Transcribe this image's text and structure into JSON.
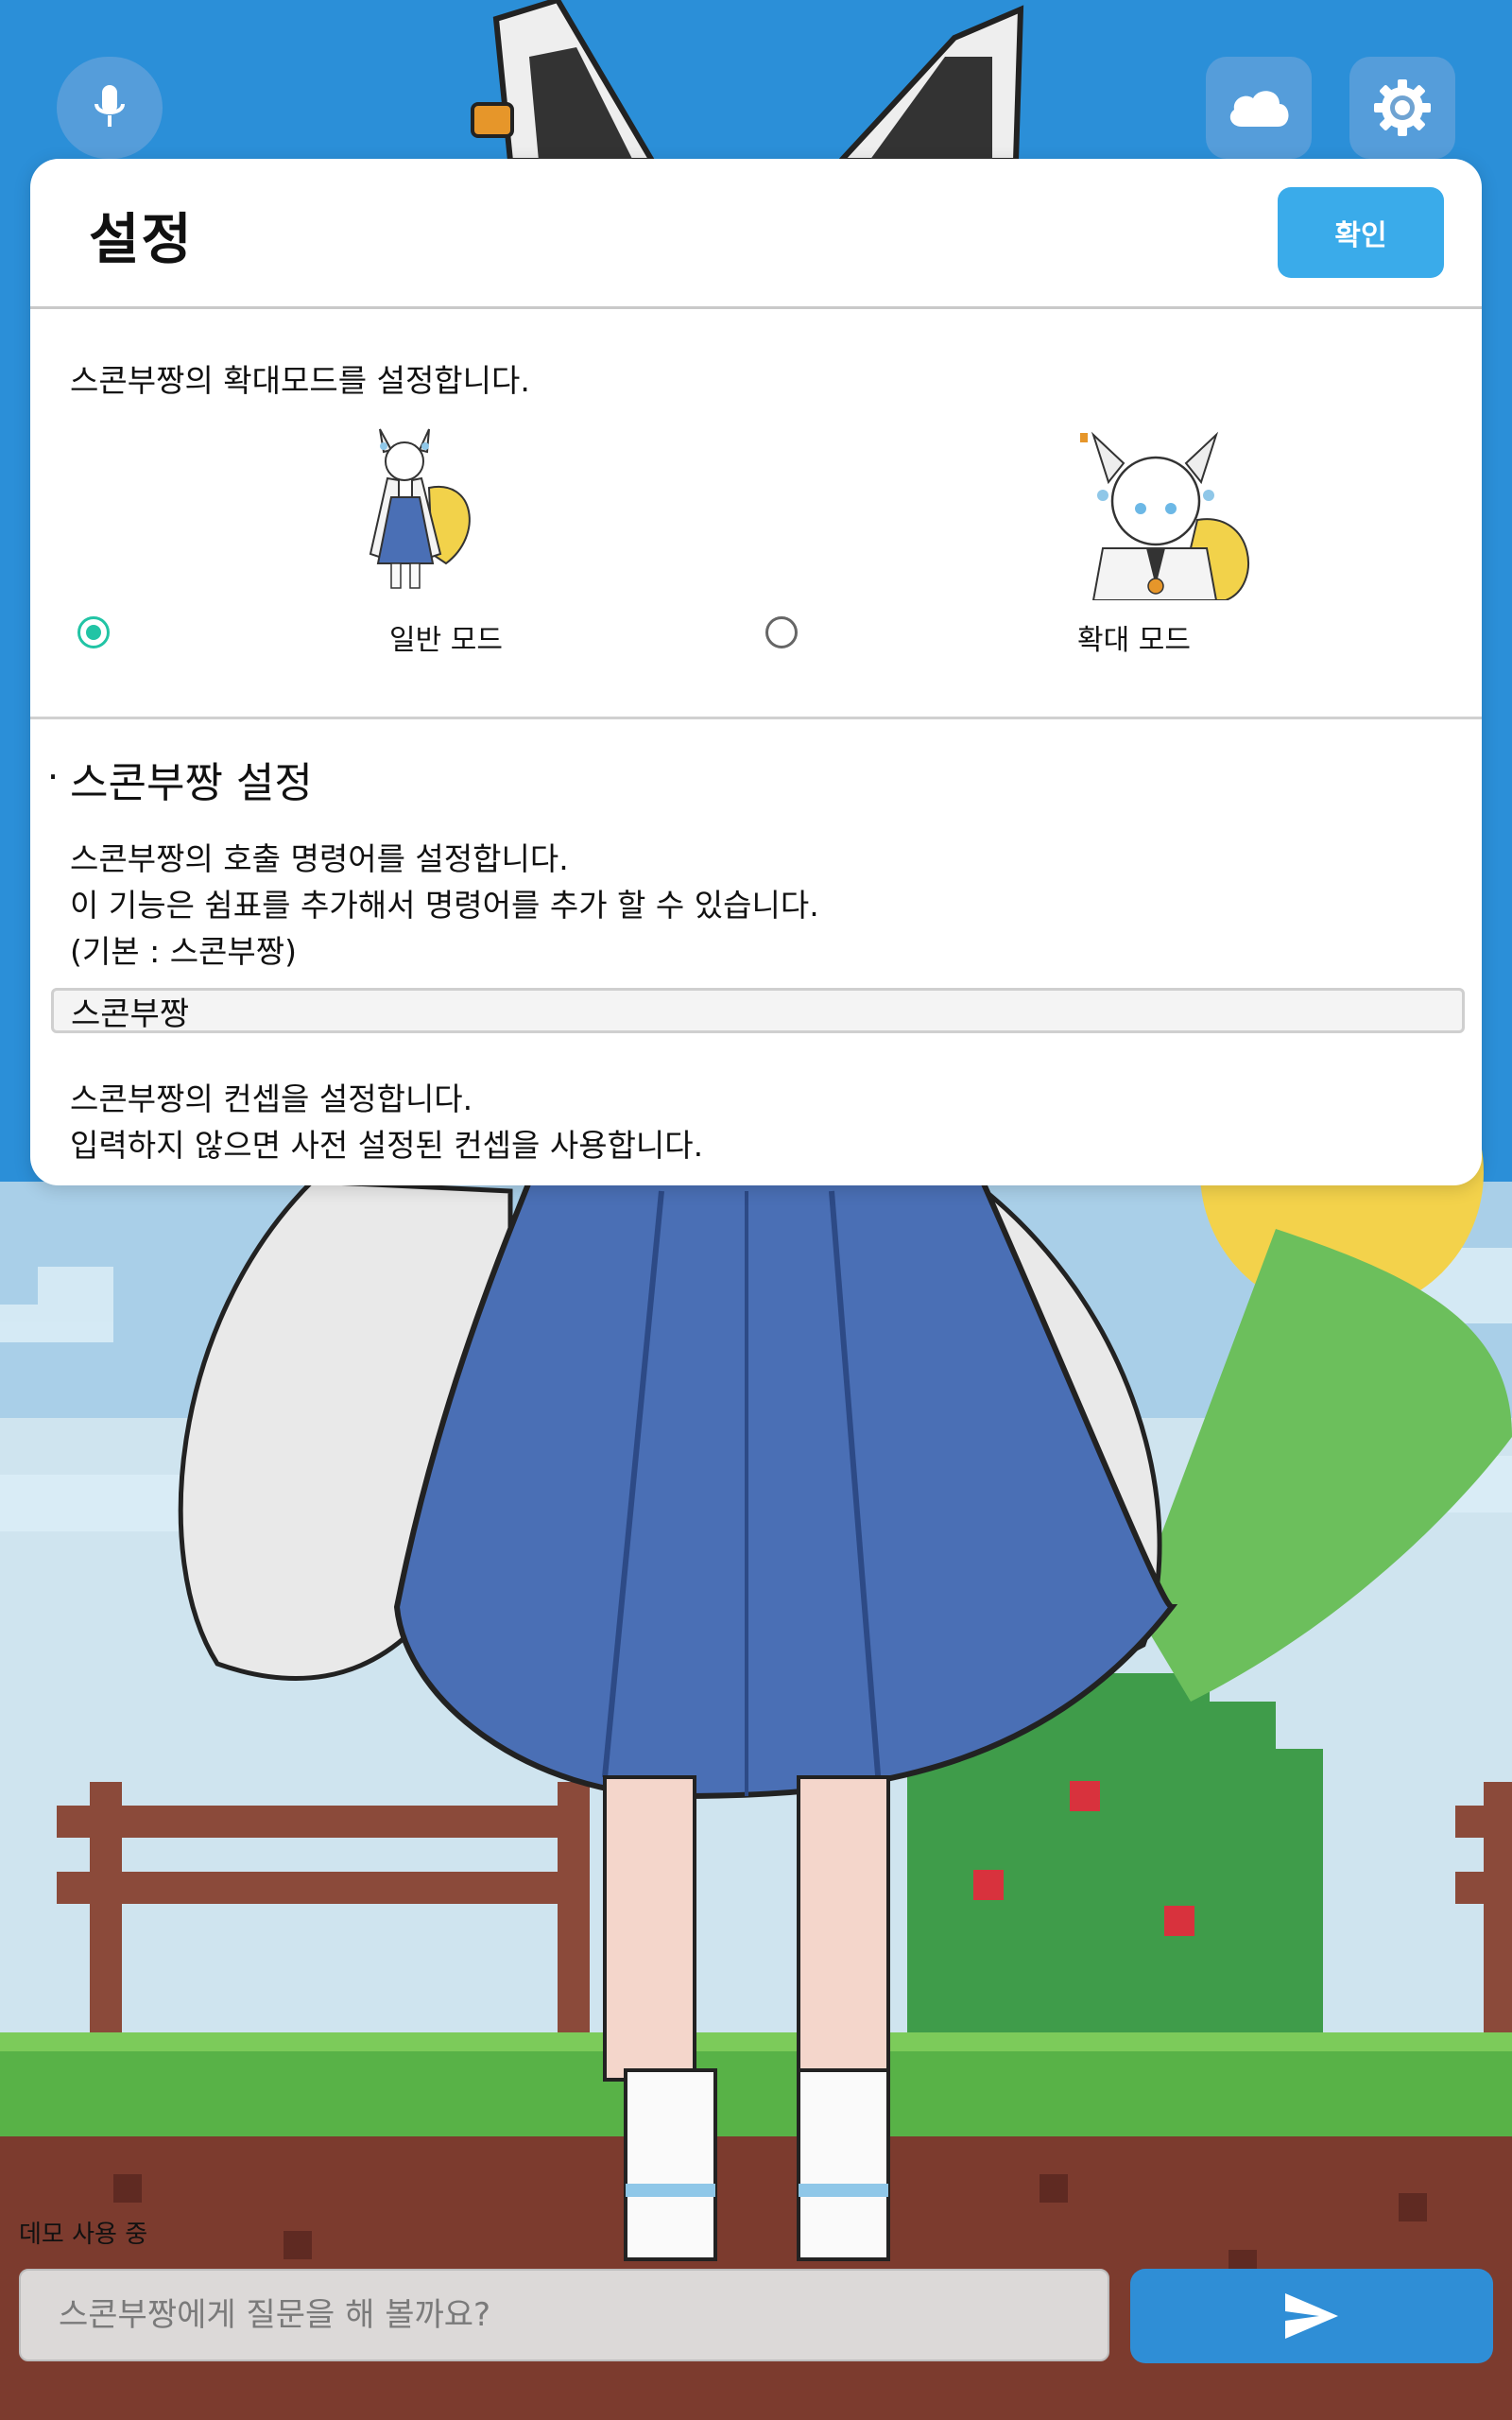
{
  "top_bar": {
    "mic_icon": "microphone-icon",
    "cloud_icon": "cloud-icon",
    "settings_icon": "gear-icon"
  },
  "dialog": {
    "title": "설정",
    "confirm_label": "확인",
    "mode_section": {
      "description": "스콘부짱의 확대모드를 설정합니다.",
      "options": [
        {
          "label": "일반 모드",
          "selected": true
        },
        {
          "label": "확대 모드",
          "selected": false
        }
      ]
    },
    "settings_section": {
      "bullet": "·",
      "title": "스콘부짱 설정",
      "call_desc_1": "스콘부짱의 호출 명령어를 설정합니다.",
      "call_desc_2": "이 기능은 쉼표를 추가해서 명령어를 추가 할 수 있습니다.",
      "call_desc_3": "(기본 : 스콘부짱)",
      "call_word_value": "스콘부짱",
      "concept_desc_1": "스콘부짱의 컨셉을 설정합니다.",
      "concept_desc_2": "입력하지 않으면 사전 설정된 컨셉을 사용합니다."
    }
  },
  "bottom": {
    "demo_label": "데모 사용 중",
    "question_placeholder": "스콘부짱에게 질문을 해 볼까요?",
    "send_icon": "send-icon"
  },
  "colors": {
    "accent": "#3aabea",
    "radio_selected": "#22c4a5",
    "sky": "#2b8fd8",
    "send_button": "#2f8ed6"
  }
}
